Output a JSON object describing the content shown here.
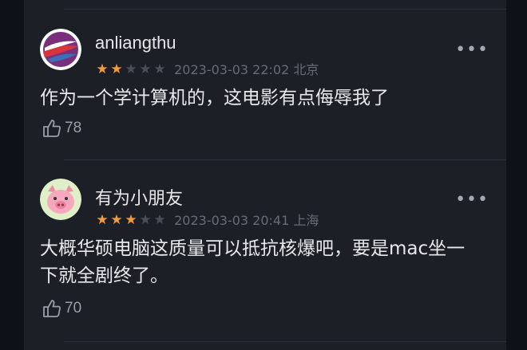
{
  "comments": [
    {
      "username": "anliangthu",
      "rating": 2,
      "max_rating": 5,
      "datetime": "2023-03-03 22:02",
      "location": "北京",
      "meta_line": "2023-03-03 22:02 北京",
      "text": "作为一个学计算机的，这电影有点侮辱我了",
      "likes": "78",
      "avatar_icon": "tsinghua-logo-icon"
    },
    {
      "username": "有为小朋友",
      "rating": 3,
      "max_rating": 5,
      "datetime": "2023-03-03 20:41",
      "location": "上海",
      "meta_line": "2023-03-03 20:41 上海",
      "text": "大概华硕电脑这质量可以抵抗核爆吧，要是mac坐一下就全剧终了。",
      "likes": "70",
      "avatar_icon": "pig-icon"
    }
  ],
  "colors": {
    "background": "#0e1117",
    "panel": "#1c1f26",
    "star_on": "#f29a3c",
    "star_off": "#4a4e57",
    "text": "#e8e8ec",
    "meta": "#666b74"
  }
}
